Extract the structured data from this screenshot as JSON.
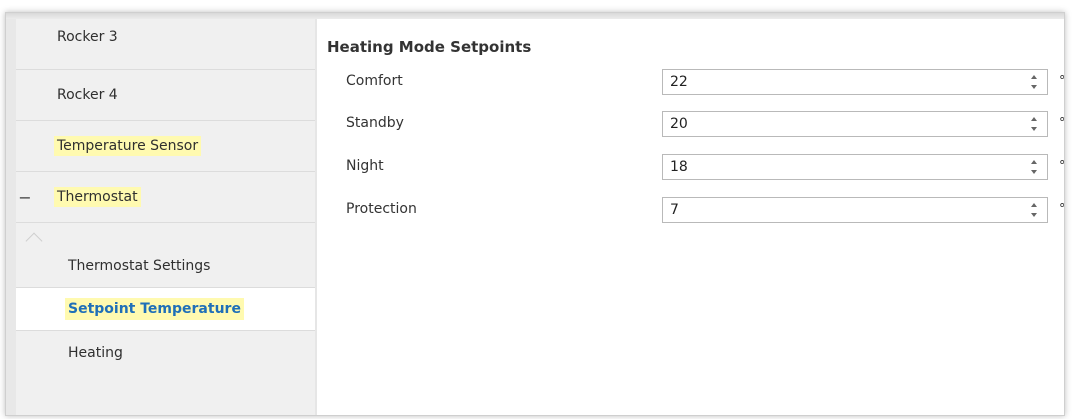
{
  "sidebar": {
    "items": [
      {
        "label": "Rocker 3"
      },
      {
        "label": "Rocker 4"
      },
      {
        "label": "Temperature Sensor"
      },
      {
        "label": "Thermostat",
        "collapse_sign": "−"
      }
    ],
    "sub_items": [
      {
        "label": "Thermostat Settings"
      },
      {
        "label": "Setpoint Temperature",
        "active": true
      },
      {
        "label": "Heating"
      }
    ]
  },
  "main": {
    "section_title": "Heating Mode Setpoints",
    "rows": [
      {
        "label": "Comfort",
        "value": "22",
        "unit": "°C"
      },
      {
        "label": "Standby",
        "value": "20",
        "unit": "°C"
      },
      {
        "label": "Night",
        "value": "18",
        "unit": "°C"
      },
      {
        "label": "Protection",
        "value": "7",
        "unit": "°C"
      }
    ]
  },
  "colors": {
    "highlight": "#fffab0",
    "active_text": "#1f6fb8",
    "sidebar_bg": "#f0f0f0"
  }
}
